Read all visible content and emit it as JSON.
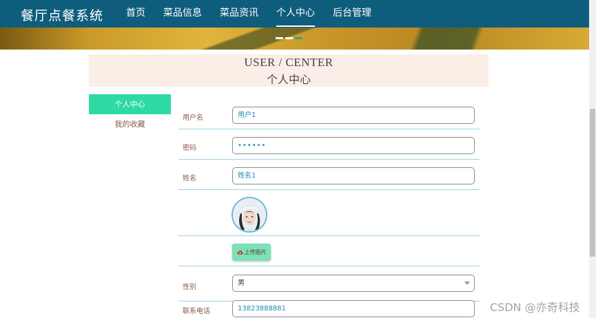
{
  "header": {
    "brand": "餐厅点餐系统",
    "nav": [
      {
        "label": "首页"
      },
      {
        "label": "菜品信息"
      },
      {
        "label": "菜品资讯"
      },
      {
        "label": "个人中心",
        "active": true
      },
      {
        "label": "后台管理"
      }
    ]
  },
  "banner": {
    "slides": 3,
    "active_slide": 3
  },
  "center": {
    "title_en": "USER / CENTER",
    "title_cn": "个人中心"
  },
  "sidebar": {
    "items": [
      {
        "label": "个人中心",
        "active": true
      },
      {
        "label": "我的收藏"
      }
    ]
  },
  "form": {
    "username": {
      "label": "用户名",
      "value": "用户1"
    },
    "password": {
      "label": "密码",
      "value": "••••••"
    },
    "name": {
      "label": "姓名",
      "value": "姓名1"
    },
    "upload_label": "上传图片",
    "gender": {
      "label": "性别",
      "value": "男"
    },
    "phone": {
      "label": "联系电话",
      "value": "13823888881"
    }
  },
  "watermark": "CSDN @亦奇科技",
  "colors": {
    "nav_bg": "#0f5d7c",
    "accent": "#2fd9a3",
    "header_bg": "#fbeee6",
    "input_text": "#1b8bb5"
  }
}
